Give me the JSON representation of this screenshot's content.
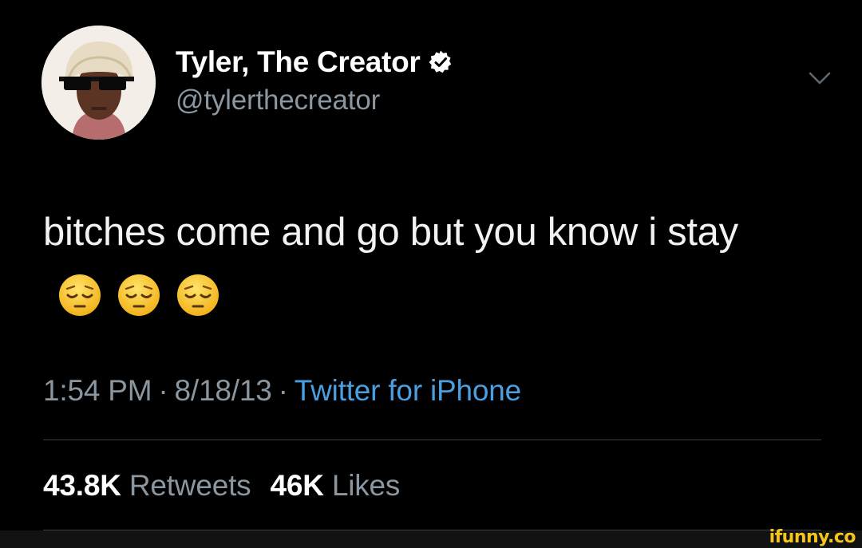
{
  "tweet": {
    "author": {
      "display_name": "Tyler, The Creator",
      "handle": "@tylerthecreator",
      "verified": true,
      "avatar_icon": "avatar-photo"
    },
    "text": "bitches come and go but you know i stay",
    "emojis": [
      "pensive-face",
      "pensive-face",
      "pensive-face"
    ],
    "time": "1:54 PM",
    "date": "8/18/13",
    "separator": "·",
    "source": "Twitter for iPhone",
    "retweets_count": "43.8K",
    "retweets_label": "Retweets",
    "likes_count": "46K",
    "likes_label": "Likes",
    "menu_icon": "chevron-down-icon"
  },
  "watermark": "ifunny.co",
  "colors": {
    "background": "#000000",
    "secondary_text": "#8a96a0",
    "link": "#4a9fe0",
    "watermark": "#f5c518"
  }
}
